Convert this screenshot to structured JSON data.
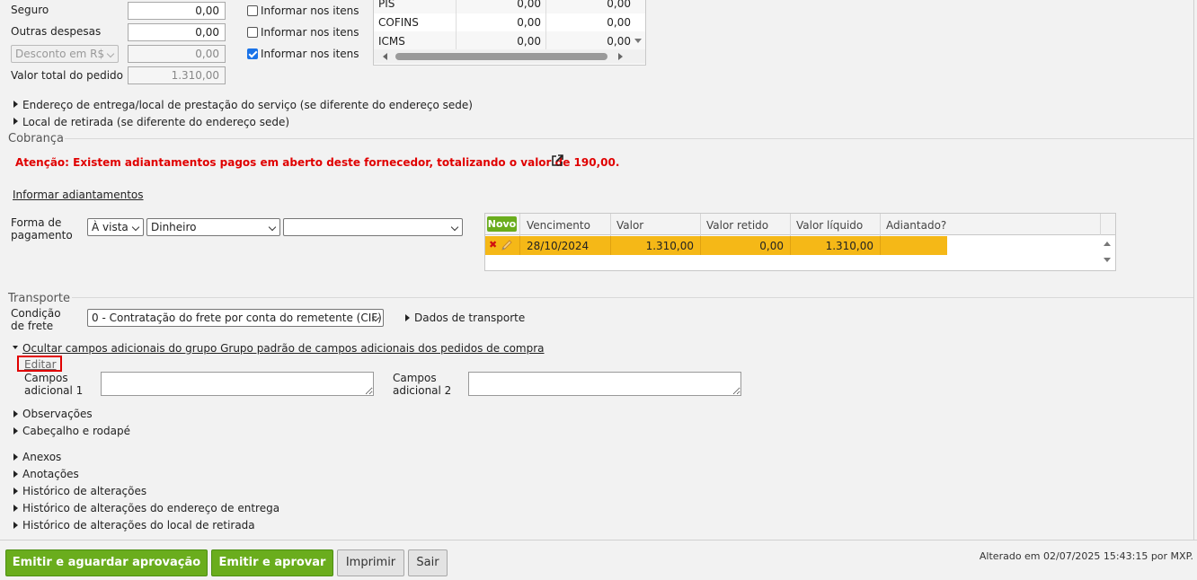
{
  "totals": {
    "rows": [
      {
        "label": "Seguro",
        "value": "0,00",
        "checkbox_label": "Informar nos itens",
        "checked": false
      },
      {
        "label": "Outras despesas",
        "value": "0,00",
        "checkbox_label": "Informar nos itens",
        "checked": false
      },
      {
        "select_label": "Desconto em R$",
        "value": "0,00",
        "checkbox_label": "Informar nos itens",
        "checked": true
      },
      {
        "label": "Valor total do pedido",
        "value": "1.310,00"
      }
    ]
  },
  "taxes": {
    "rows": [
      {
        "name": "PIS",
        "v1": "0,00",
        "v2": "0,00"
      },
      {
        "name": "COFINS",
        "v1": "0,00",
        "v2": "0,00"
      },
      {
        "name": "ICMS",
        "v1": "0,00",
        "v2": "0,00"
      }
    ]
  },
  "expanders_top": [
    "Endereço de entrega/local de prestação do serviço (se diferente do endereço sede)",
    "Local de retirada (se diferente do endereço sede)"
  ],
  "cobranca": {
    "title": "Cobrança",
    "alert": "Atenção: Existem adiantamentos pagos em aberto deste fornecedor, totalizando o valor de 190,00.",
    "informar_link": "Informar adiantamentos",
    "forma_label": "Forma de pagamento",
    "forma_sel1": "À vista",
    "forma_sel2": "Dinheiro",
    "forma_sel3": "",
    "grid": {
      "novo_label": "Novo",
      "headers": [
        "Vencimento",
        "Valor",
        "Valor retido",
        "Valor líquido",
        "Adiantado?"
      ],
      "rows": [
        {
          "vencimento": "28/10/2024",
          "valor": "1.310,00",
          "retido": "0,00",
          "liquido": "1.310,00",
          "adiantado": ""
        }
      ]
    }
  },
  "transporte": {
    "title": "Transporte",
    "condicao_label": "Condição de frete",
    "condicao_value": "0 - Contratação do frete por conta do remetente (CIF)",
    "dados_label": "Dados de transporte"
  },
  "campos": {
    "ocultar_label": "Ocultar campos adicionais do grupo Grupo padrão de campos adicionais dos pedidos de compra",
    "editar_label": "Editar",
    "campo1_label": "Campos adicional 1",
    "campo2_label": "Campos adicional 2"
  },
  "expanders_bottom": [
    "Observações",
    "Cabeçalho e rodapé",
    "Anexos",
    "Anotações",
    "Histórico de alterações",
    "Histórico de alterações do endereço de entrega",
    "Histórico de alterações do local de retirada"
  ],
  "footer": {
    "btn_emitir_aguardar": "Emitir e aguardar aprovação",
    "btn_emitir_aprovar": "Emitir e aprovar",
    "btn_imprimir": "Imprimir",
    "btn_sair": "Sair",
    "status": "Alterado em 02/07/2025 15:43:15 por MXP."
  },
  "colors": {
    "accent_green": "#6aad1d",
    "alert_red": "#e00000",
    "highlight_row": "#f5b817",
    "editar_box": "#e00000"
  }
}
